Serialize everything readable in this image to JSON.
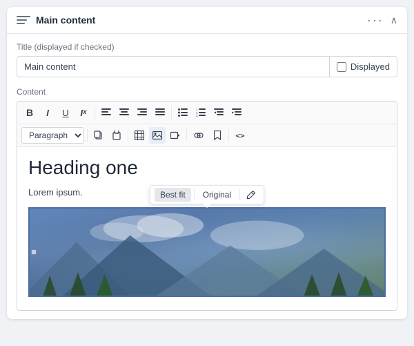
{
  "panel": {
    "title": "Main content",
    "dots_label": "···",
    "chevron_label": "∧"
  },
  "title_field": {
    "label": "Title (displayed if checked)",
    "value": "Main content",
    "placeholder": "Main content",
    "checkbox_label": "Displayed",
    "checked": false
  },
  "content_section": {
    "label": "Content"
  },
  "toolbar": {
    "bold": "B",
    "italic": "I",
    "underline": "U",
    "strikethrough": "Ix",
    "align_left": "≡",
    "align_center": "≡",
    "align_right": "≡",
    "justify": "≡",
    "bullet_list": "☰",
    "ordered_list": "☰",
    "indent_decrease": "☰",
    "indent_increase": "☰",
    "paragraph_label": "Paragraph",
    "copy": "⧉",
    "paste": "⧉",
    "table": "⊞",
    "image": "🖼",
    "media": "⬚",
    "link": "🔗",
    "bookmark": "🔖",
    "source": "<>"
  },
  "editor": {
    "heading": "Heading one",
    "paragraph": "Lorem ipsum.",
    "image_toolbar": {
      "best_fit": "Best fit",
      "original": "Original",
      "edit_icon": "✎"
    }
  }
}
